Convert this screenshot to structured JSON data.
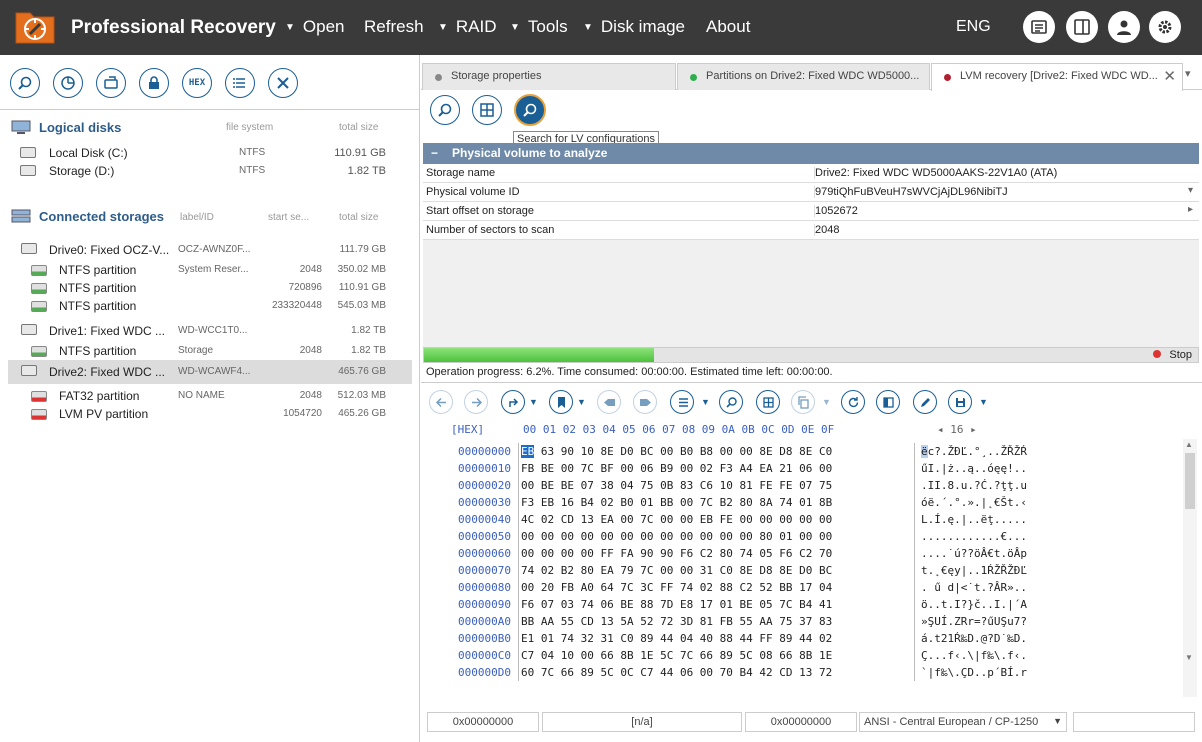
{
  "app": {
    "title": "Professional Recovery",
    "menu": [
      {
        "label": "Open",
        "has_dropdown": true
      },
      {
        "label": "Refresh",
        "has_dropdown": false
      },
      {
        "label": "RAID",
        "has_dropdown": true
      },
      {
        "label": "Tools",
        "has_dropdown": true
      },
      {
        "label": "Disk image",
        "has_dropdown": true
      },
      {
        "label": "About",
        "has_dropdown": false
      }
    ],
    "language": "ENG",
    "toolbar_icons": [
      "log-icon",
      "panels-icon",
      "user-icon",
      "settings-icon"
    ]
  },
  "left_panel": {
    "command_icons": [
      "search-icon",
      "scan-icon",
      "disk-image-icon",
      "lock-icon",
      "hex-icon",
      "list-icon",
      "close-icon"
    ],
    "hex_label": "HEX",
    "logical_disks": {
      "title": "Logical disks",
      "col_fs": "file system",
      "col_size": "total size",
      "items": [
        {
          "name": "Local Disk (C:)",
          "fs": "NTFS",
          "size": "110.91 GB"
        },
        {
          "name": "Storage (D:)",
          "fs": "NTFS",
          "size": "1.82 TB"
        }
      ]
    },
    "connected_storages": {
      "title": "Connected storages",
      "col_label": "label/ID",
      "col_start": "start se...",
      "col_size": "total size",
      "items": [
        {
          "name": "Drive0: Fixed OCZ-V...",
          "label": "OCZ-AWNZ0F...",
          "start": "",
          "size": "111.79 GB",
          "kind": "drive"
        },
        {
          "name": "NTFS partition",
          "label": "System Reser...",
          "start": "2048",
          "size": "350.02 MB",
          "kind": "part"
        },
        {
          "name": "NTFS partition",
          "label": "",
          "start": "720896",
          "size": "110.91 GB",
          "kind": "part"
        },
        {
          "name": "NTFS partition",
          "label": "",
          "start": "233320448",
          "size": "545.03 MB",
          "kind": "part"
        },
        {
          "name": "Drive1: Fixed WDC ...",
          "label": "WD-WCC1T0...",
          "start": "",
          "size": "1.82 TB",
          "kind": "drive"
        },
        {
          "name": "NTFS partition",
          "label": "Storage",
          "start": "2048",
          "size": "1.82 TB",
          "kind": "part"
        },
        {
          "name": "Drive2: Fixed WDC ...",
          "label": "WD-WCAWF4...",
          "start": "",
          "size": "465.76 GB",
          "kind": "drive",
          "selected": true
        },
        {
          "name": "FAT32 partition",
          "label": "NO NAME",
          "start": "2048",
          "size": "512.03 MB",
          "kind": "part-red"
        },
        {
          "name": "LVM PV partition",
          "label": "",
          "start": "1054720",
          "size": "465.26 GB",
          "kind": "part-red"
        }
      ]
    }
  },
  "tabs": [
    {
      "label": "Storage properties",
      "status_color": "#888888"
    },
    {
      "label": "Partitions on Drive2: Fixed WDC WD5000...",
      "status_color": "#2fae4f"
    },
    {
      "label": "LVM recovery [Drive2: Fixed WDC WD...",
      "status_color": "#b02030",
      "active": true
    }
  ],
  "lvm": {
    "tool_icons": [
      "search-icon",
      "grid-icon",
      "search-lv-icon"
    ],
    "tooltip": "Search for LV configurations",
    "section_title": "Physical volume to analyze",
    "properties": [
      {
        "name": "Storage name",
        "value": "Drive2: Fixed WDC WD5000AAKS-22V1A0 (ATA)",
        "control": ""
      },
      {
        "name": "Physical volume ID",
        "value": "979tiQhFuBVeuH7sWVCjAjDL96NibiTJ",
        "control": "▾"
      },
      {
        "name": "Start offset on storage",
        "value": "1052672",
        "control": "▸"
      },
      {
        "name": "Number of sectors to scan",
        "value": "2048",
        "control": ""
      }
    ],
    "progress": 0.062,
    "stop_label": "Stop",
    "status": "Operation progress: 6.2%. Time consumed: 00:00:00. Estimated time left: 00:00:00."
  },
  "hex": {
    "header_left": "[HEX]",
    "columns": "00 01 02 03 04 05 06 07 08 09 0A 0B 0C 0D 0E 0F",
    "width_label": "◂ 16 ▸",
    "rows": [
      {
        "addr": "00000000",
        "bytes": "EB 63 90 10 8E D0 BC 00 B0 B8 00 00 8E D8 8E C0",
        "text": "ëc?.ŽĐĽ.°¸..ŽŘŽŔ"
      },
      {
        "addr": "00000010",
        "bytes": "FB BE 00 7C BF 00 06 B9 00 02 F3 A4 EA 21 06 00",
        "text": "űI.|ż..ą..óęę!.."
      },
      {
        "addr": "00000020",
        "bytes": "00 BE BE 07 38 04 75 0B 83 C6 10 81 FE FE 07 75",
        "text": ".II.8.u.?Ć.?ţţ.u"
      },
      {
        "addr": "00000030",
        "bytes": "F3 EB 16 B4 02 B0 01 BB 00 7C B2 80 8A 74 01 8B",
        "text": "óë.´.°.».|˛€Št.‹"
      },
      {
        "addr": "00000040",
        "bytes": "4C 02 CD 13 EA 00 7C 00 00 EB FE 00 00 00 00 00",
        "text": "L.Í.ę.|..ëţ....."
      },
      {
        "addr": "00000050",
        "bytes": "00 00 00 00 00 00 00 00 00 00 00 00 80 01 00 00",
        "text": "............€..."
      },
      {
        "addr": "00000060",
        "bytes": "00 00 00 00 FF FA 90 90 F6 C2 80 74 05 F6 C2 70",
        "text": "....˙ú??öÂ€t.öÂp"
      },
      {
        "addr": "00000070",
        "bytes": "74 02 B2 80 EA 79 7C 00 00 31 C0 8E D8 8E D0 BC",
        "text": "t.˛€ęy|..1ŔŽŘŽĐĽ"
      },
      {
        "addr": "00000080",
        "bytes": "00 20 FB A0 64 7C 3C FF 74 02 88 C2 52 BB 17 04",
        "text": ". ű d|<˙t.?ÂR».."
      },
      {
        "addr": "00000090",
        "bytes": "F6 07 03 74 06 BE 88 7D E8 17 01 BE 05 7C B4 41",
        "text": "ö..t.I?}č..I.|´A"
      },
      {
        "addr": "000000A0",
        "bytes": "BB AA 55 CD 13 5A 52 72 3D 81 FB 55 AA 75 37 83",
        "text": "»ŞUÍ.ZRr=?űUŞu7?"
      },
      {
        "addr": "000000B0",
        "bytes": "E1 01 74 32 31 C0 89 44 04 40 88 44 FF 89 44 02",
        "text": "á.t21Ŕ‰D.@?D˙‰D."
      },
      {
        "addr": "000000C0",
        "bytes": "C7 04 10 00 66 8B 1E 5C 7C 66 89 5C 08 66 8B 1E",
        "text": "Ç...f‹.\\|f‰\\.f‹."
      },
      {
        "addr": "000000D0",
        "bytes": "60 7C 66 89 5C 0C C7 44 06 00 70 B4 42 CD 13 72",
        "text": "`|f‰\\.ÇD..p´BÍ.r"
      }
    ],
    "selected_byte": "EB",
    "selected_char": "ë",
    "status": {
      "offset": "0x00000000",
      "value": "[n/a]",
      "offset2": "0x00000000",
      "encoding": "ANSI - Central European / CP-1250"
    }
  }
}
